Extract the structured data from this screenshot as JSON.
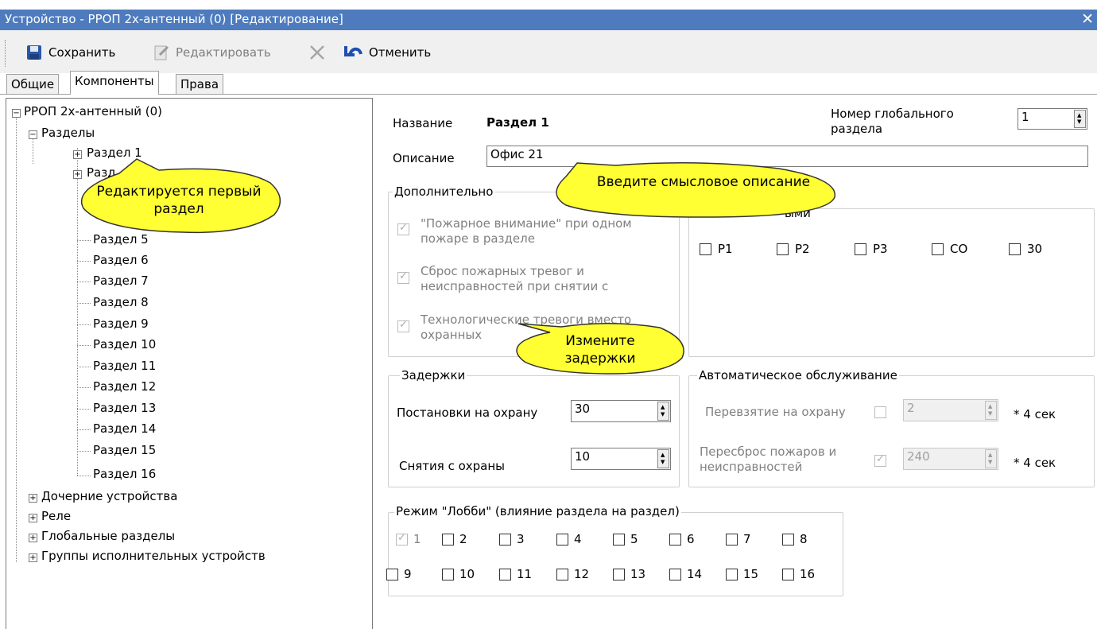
{
  "window": {
    "title": "Устройство - РРОП 2х-антенный (0) [Редактирование]",
    "close_glyph": "✕"
  },
  "toolbar": {
    "save": "Сохранить",
    "edit": "Редактировать",
    "cancel": "Отменить"
  },
  "tabs": [
    "Общие",
    "Компоненты",
    "Права"
  ],
  "tree": {
    "root": "РРОП 2х-антенный (0)",
    "sections_label": "Разделы",
    "sections": [
      "Раздел 1",
      "Разд",
      "Раздел 5",
      "Раздел 6",
      "Раздел 7",
      "Раздел 8",
      "Раздел 9",
      "Раздел 10",
      "Раздел 11",
      "Раздел 12",
      "Раздел 13",
      "Раздел 14",
      "Раздел 15",
      "Раздел 16"
    ],
    "others": [
      "Дочерние устройства",
      "Реле",
      "Глобальные разделы",
      "Группы исполнительных устройств"
    ]
  },
  "form": {
    "name_label": "Название",
    "name_value": "Раздел 1",
    "global_number_label": "Номер глобального раздела",
    "global_number_value": "1",
    "description_label": "Описание",
    "description_value": "Офис 21",
    "extra_title": "Дополнительно",
    "extra_options": [
      "\"Пожарное внимание\" при одном пожаре в разделе",
      "Сброс пожарных тревог и неисправностей при снятии с",
      "Технологические тревоги вместо охранных"
    ],
    "right_group_title": "ыми",
    "right_group_checks": [
      "P1",
      "P2",
      "P3",
      "CO",
      "30"
    ],
    "delays_title": "Задержки",
    "arm_label": "Постановки на охрану",
    "arm_value": "30",
    "disarm_label": "Снятия с охраны",
    "disarm_value": "10",
    "auto_title": "Автоматическое обслуживание",
    "rearm_label": "Перевзятие на охрану",
    "rearm_value": "2",
    "reset_label": "Пересброс пожаров и неисправностей",
    "reset_value": "240",
    "unit": "* 4 сек",
    "lobby_title": "Режим \"Лобби\" (влияние раздела на раздел)",
    "lobby": [
      "1",
      "2",
      "3",
      "4",
      "5",
      "6",
      "7",
      "8",
      "9",
      "10",
      "11",
      "12",
      "13",
      "14",
      "15",
      "16"
    ]
  },
  "callouts": {
    "c1": "Редактируется первый раздел",
    "c2": "Введите смысловое описание",
    "c3": "Измените задержки"
  },
  "colors": {
    "titlebar": "#4d7bbd",
    "callout": "#ffff33"
  }
}
